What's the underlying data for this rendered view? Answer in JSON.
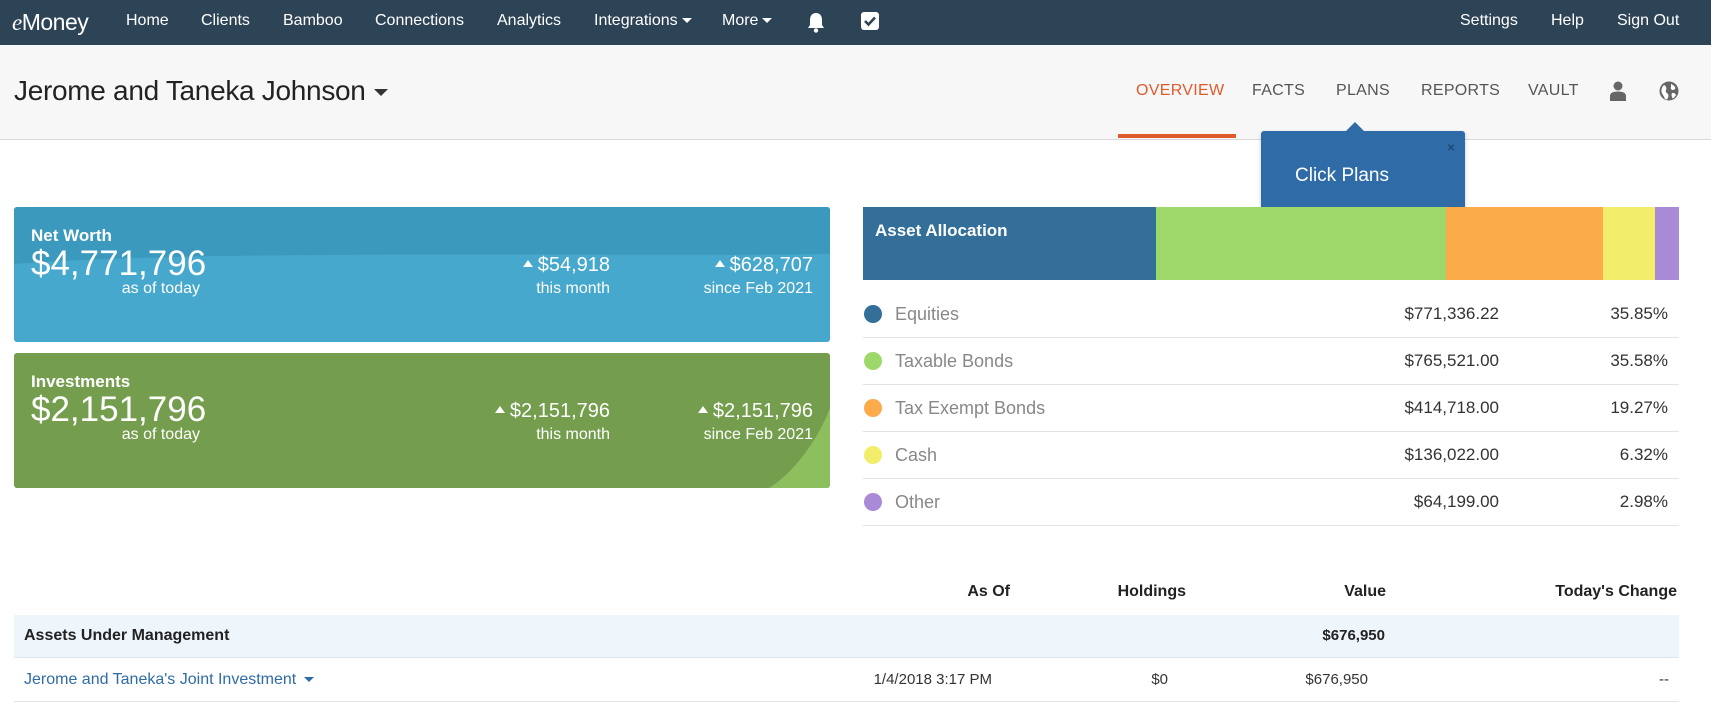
{
  "topnav": {
    "logo_e": "e",
    "logo_rest": "Money",
    "items": [
      "Home",
      "Clients",
      "Bamboo",
      "Connections",
      "Analytics",
      "Integrations",
      "More"
    ],
    "right_items": [
      "Settings",
      "Help",
      "Sign Out"
    ],
    "icons": [
      "bell-icon",
      "checkbox-icon"
    ]
  },
  "client": {
    "name": "Jerome and Taneka Johnson",
    "tabs": [
      "OVERVIEW",
      "FACTS",
      "PLANS",
      "REPORTS",
      "VAULT"
    ],
    "active_tab": "OVERVIEW",
    "icons": [
      "person-icon",
      "globe-icon"
    ]
  },
  "tooltip": {
    "text": "Click Plans",
    "close": "×"
  },
  "net_worth": {
    "title": "Net Worth",
    "value": "$4,771,796",
    "value_sub": "as of today",
    "month_change": "$54,918",
    "month_sub": "this month",
    "since_change": "$628,707",
    "since_sub": "since Feb 2021"
  },
  "investments": {
    "title": "Investments",
    "value": "$2,151,796",
    "value_sub": "as of today",
    "month_change": "$2,151,796",
    "month_sub": "this month",
    "since_change": "$2,151,796",
    "since_sub": "since Feb 2021"
  },
  "asset_allocation": {
    "title": "Asset Allocation",
    "rows": [
      {
        "name": "Equities",
        "amount": "$771,336.22",
        "percent": "35.85%",
        "share": 35.85,
        "color": "#336f99"
      },
      {
        "name": "Taxable Bonds",
        "amount": "$765,521.00",
        "percent": "35.58%",
        "share": 35.58,
        "color": "#9fd86a"
      },
      {
        "name": "Tax Exempt Bonds",
        "amount": "$414,718.00",
        "percent": "19.27%",
        "share": 19.27,
        "color": "#fbab4a"
      },
      {
        "name": "Cash",
        "amount": "$136,022.00",
        "percent": "6.32%",
        "share": 6.32,
        "color": "#f2ed6a"
      },
      {
        "name": "Other",
        "amount": "$64,199.00",
        "percent": "2.98%",
        "share": 2.98,
        "color": "#a98ad6"
      }
    ]
  },
  "table": {
    "headers": {
      "as_of": "As Of",
      "holdings": "Holdings",
      "value": "Value",
      "todays_change": "Today's Change"
    },
    "aum": {
      "label": "Assets Under Management",
      "value": "$676,950"
    },
    "accounts": [
      {
        "name": "Jerome and Taneka's Joint Investment",
        "as_of": "1/4/2018 3:17 PM",
        "holdings": "$0",
        "value": "$676,950",
        "todays_change": "--"
      }
    ]
  },
  "colors": {
    "nav_bg": "#2d4356",
    "accent": "#e05a2c",
    "net_worth_card": "#45a8cc",
    "investments_card": "#749e4e",
    "tooltip": "#2f6ba6"
  }
}
